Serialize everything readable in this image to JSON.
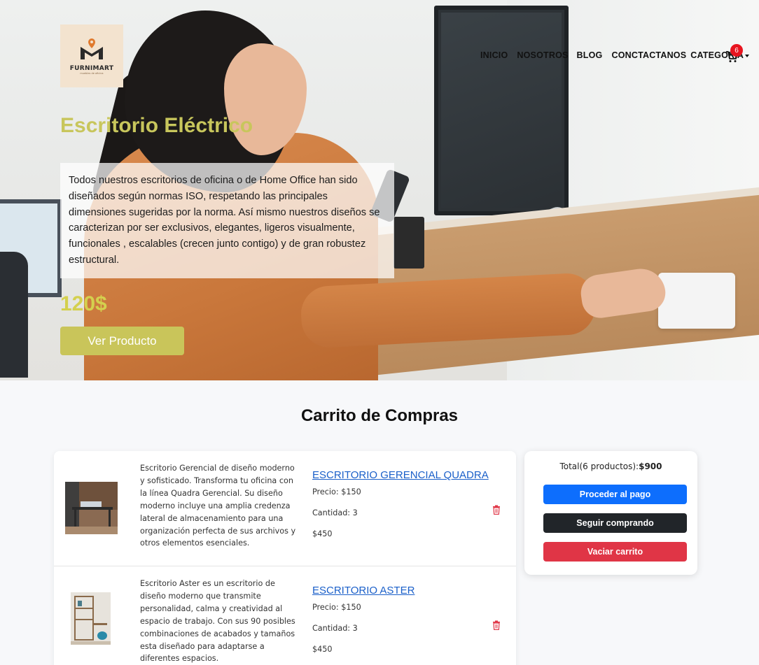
{
  "brand": {
    "name": "FURNIMART",
    "tagline": "muebles de oficina"
  },
  "nav": {
    "items": [
      "INICIO",
      "NOSOTROS",
      "BLOG",
      "CONCTACTANOS",
      "CATEGORIA"
    ],
    "cart_count": "6"
  },
  "hero": {
    "title": "Escritorio Eléctrico",
    "description": "Todos nuestros escritorios de oficina o de Home Office han sido diseñados según normas ISO, respetando las principales dimensiones sugeridas por la norma. Así mismo nuestros diseños se caracterizan por ser exclusivos, elegantes, ligeros visualmente, funcionales , escalables (crecen junto contigo) y de gran robustez estructural.",
    "price": "120$",
    "button": "Ver Producto"
  },
  "cart": {
    "title": "Carrito de Compras",
    "items": [
      {
        "description": "Escritorio Gerencial de diseño moderno y sofisticado. Transforma tu oficina con la línea Quadra Gerencial. Su diseño moderno incluye una amplia credenza lateral de almacenamiento para una organización perfecta de sus archivos y otros elementos esenciales.",
        "name": "ESCRITORIO GERENCIAL QUADRA",
        "price": "Precio: $150",
        "quantity": "Cantidad: 3",
        "subtotal": "$450"
      },
      {
        "description": "Escritorio Aster es un escritorio de diseño moderno que transmite personalidad, calma y creatividad al espacio de trabajo. Con sus 90 posibles combinaciones de acabados y tamaños esta diseñado para adaptarse a diferentes espacios.",
        "name": "ESCRITORIO ASTER",
        "price": "Precio: $150",
        "quantity": "Cantidad: 3",
        "subtotal": "$450"
      }
    ]
  },
  "summary": {
    "total_label": "Total(6 productos):",
    "total_value": "$900",
    "pay_button": "Proceder al pago",
    "continue_button": "Seguir comprando",
    "empty_button": "Vaciar carrito"
  },
  "colors": {
    "accent_olive": "#c9c55a",
    "primary_blue": "#0d6efd",
    "dark": "#212529",
    "danger": "#e03546",
    "badge_red": "#e8141f",
    "link_blue": "#1a5fc9"
  },
  "icons": [
    "cart-icon",
    "trash-icon",
    "caret-down-icon"
  ]
}
